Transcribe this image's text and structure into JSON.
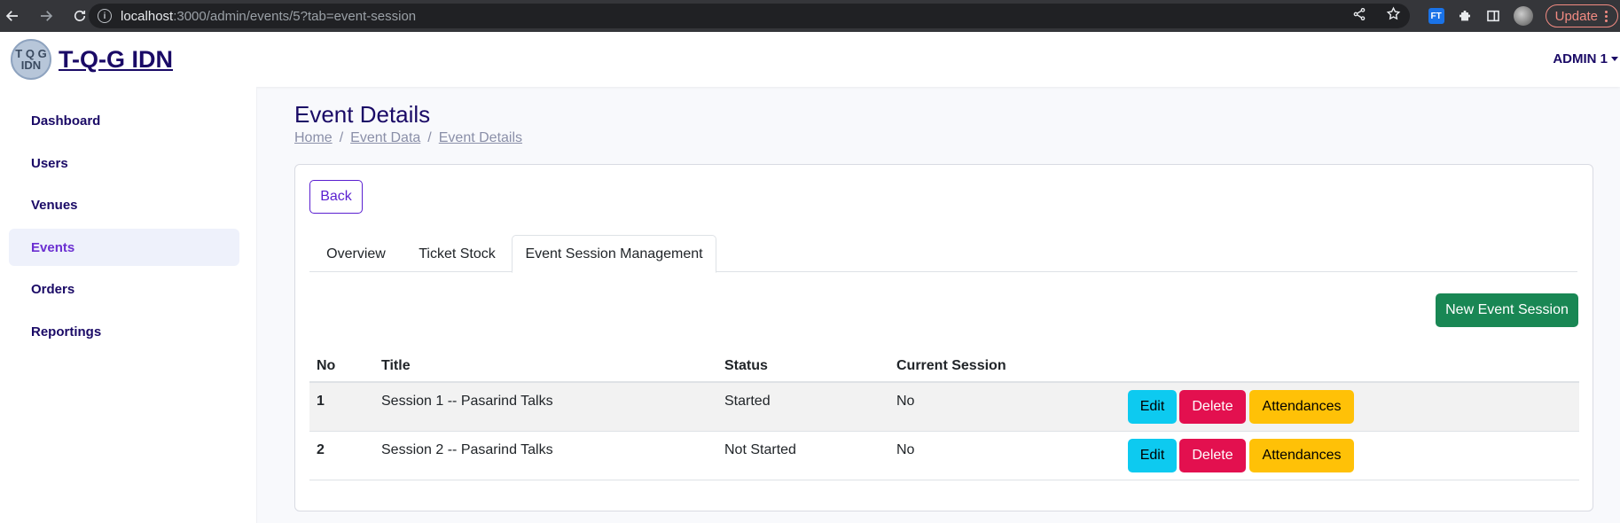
{
  "browser": {
    "url_host": "localhost",
    "url_rest": ":3000/admin/events/5?tab=event-session",
    "update_label": "Update",
    "ext_ft_label": "FT"
  },
  "header": {
    "logo_line1": "T Q G",
    "logo_line2": "IDN",
    "brand": "T-Q-G IDN",
    "admin_label": "ADMIN 1"
  },
  "sidebar": {
    "items": [
      {
        "label": "Dashboard"
      },
      {
        "label": "Users"
      },
      {
        "label": "Venues"
      },
      {
        "label": "Events",
        "active": true
      },
      {
        "label": "Orders"
      },
      {
        "label": "Reportings"
      }
    ]
  },
  "main": {
    "title": "Event Details",
    "breadcrumb": [
      "Home",
      "Event Data",
      "Event Details"
    ],
    "breadcrumb_sep": "/",
    "back_label": "Back",
    "tabs": [
      {
        "label": "Overview"
      },
      {
        "label": "Ticket Stock"
      },
      {
        "label": "Event Session Management",
        "active": true
      }
    ],
    "new_session_label": "New Event Session",
    "table": {
      "headers": [
        "No",
        "Title",
        "Status",
        "Current Session"
      ],
      "rows": [
        {
          "no": "1",
          "title": "Session 1 -- Pasarind Talks",
          "status": "Started",
          "current": "No"
        },
        {
          "no": "2",
          "title": "Session 2 -- Pasarind Talks",
          "status": "Not Started",
          "current": "No"
        }
      ],
      "actions": {
        "edit": "Edit",
        "delete": "Delete",
        "attendances": "Attendances"
      }
    }
  },
  "colors": {
    "brand": "#1a0a66",
    "active_link": "#6b2fd1",
    "success": "#198754",
    "info": "#0dcaf0",
    "danger": "#e3104f",
    "warning": "#ffc107"
  }
}
